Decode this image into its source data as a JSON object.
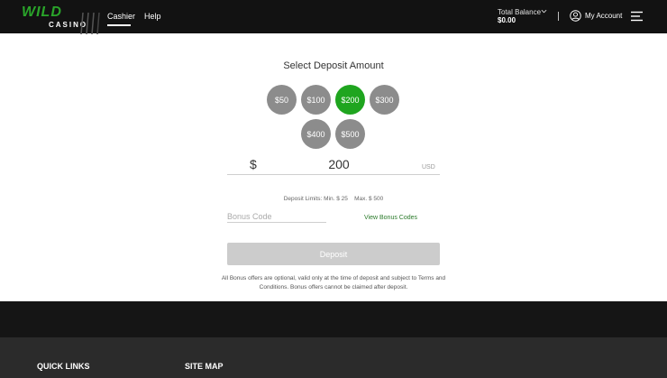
{
  "header": {
    "logo_top": "WILD",
    "logo_bottom": "CASINO",
    "nav": {
      "cashier": "Cashier",
      "help": "Help"
    },
    "balance_label": "Total Balance",
    "balance_value": "$0.00",
    "account_label": "My Account"
  },
  "deposit": {
    "title": "Select Deposit Amount",
    "amounts": [
      "$50",
      "$100",
      "$200",
      "$300",
      "$400",
      "$500"
    ],
    "selected": "$200",
    "currency_symbol": "$",
    "amount_value": "200",
    "currency_code": "USD",
    "limits_text": "Deposit Limits: Min. $ 25    Max. $ 500",
    "bonus_placeholder": "Bonus Code",
    "view_bonus_codes": "View Bonus Codes",
    "deposit_button": "Deposit",
    "disclaimer": "All Bonus offers are optional, valid only at the time of deposit and subject to Terms and Conditions. Bonus offers cannot be claimed after deposit."
  },
  "footer": {
    "quick_links": "QUICK LINKS",
    "site_map": "SITE MAP"
  },
  "colors": {
    "header_bg": "#121212",
    "brand_green": "#2aa52a",
    "active_amount": "#1fa51f",
    "inactive_amount": "#8c8c8c",
    "link_green": "#2a7a2a",
    "disabled_button": "#cccccc"
  }
}
